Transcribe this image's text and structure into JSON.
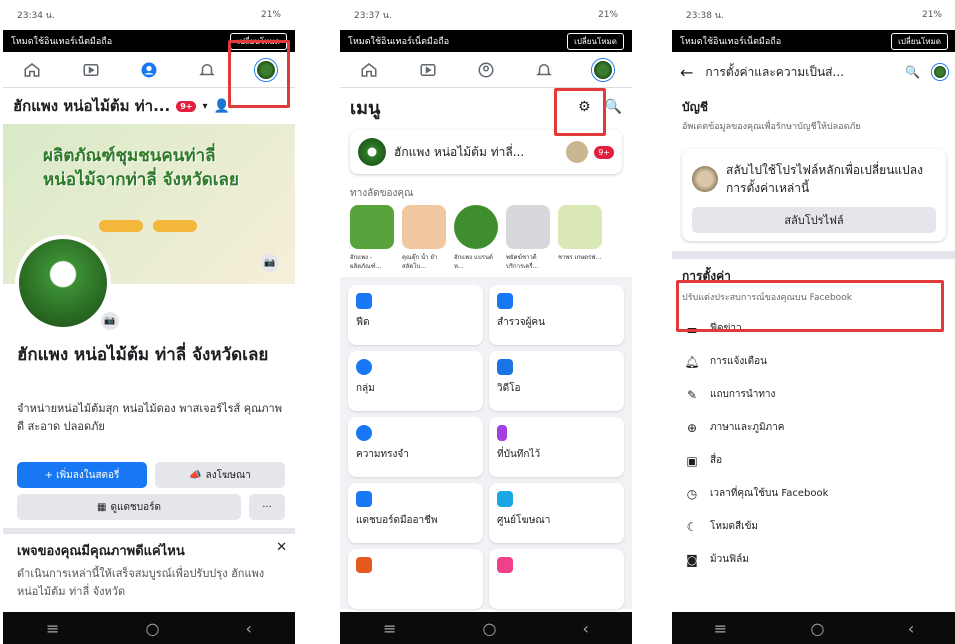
{
  "status": {
    "p1_time": "23:34 น.",
    "p2_time": "23:37 น.",
    "p3_time": "23:38 น.",
    "p1_battery": "21%",
    "p2_battery": "21%",
    "p3_battery": "21%"
  },
  "modebar": {
    "label": "โหมดใช้อินเทอร์เน็ตมือถือ",
    "button": "เปลี่ยนโหมด"
  },
  "panel1": {
    "page_header": "ฮักแพง หน่อไม้ต้ม ท่า...",
    "notif_badge": "9+",
    "cover_title_1": "ผลิตภัณฑ์ชุมชนคนท่าลี่",
    "cover_title_2": "หน่อไม้จากท่าลี่ จังหวัดเลย",
    "page_name": "ฮักแพง หน่อไม้ต้ม ท่าลี่ จังหวัดเลย",
    "page_desc": "จำหน่ายหน่อไม้ต้มสุก หน่อไม้ดอง พาสเจอร์ไรส์ คุณภาพดี สะอาด ปลอดภัย",
    "add_story": "+ เพิ่มลงในสตอรี่",
    "advertise": "ลงโฆษณา",
    "dashboard": "ดูแดชบอร์ด",
    "more": "···",
    "suggest_title": "เพจของคุณมีคุณภาพดีแค่ไหน",
    "suggest_body": "ดำเนินการเหล่านี้ให้เสร็จสมบูรณ์เพื่อปรับปรุง ฮักแพง หน่อไม้ต้ม ท่าลี่ จังหวัด"
  },
  "panel2": {
    "menu_title": "เมนู",
    "profile_name": "ฮักแพง หน่อไม้ต้ม ท่าลี่...",
    "profile_badge": "9+",
    "shortcuts_label": "ทางลัดของคุณ",
    "shortcuts": [
      {
        "label": "ฮักแพง - ผลิตภัณฑ์..."
      },
      {
        "label": "คุณตุ๊ก น้ำ ยำสลัดโบ..."
      },
      {
        "label": "ฮักแพง แบรนด์ ห..."
      },
      {
        "label": "พยัคฆ์ชาวดี บริการเครื่..."
      },
      {
        "label": "ชาพร เกษตรฟ..."
      }
    ],
    "tiles": [
      {
        "label": "ฟีด",
        "color": "#1877f2"
      },
      {
        "label": "สำรวจผู้คน",
        "color": "#1877f2"
      },
      {
        "label": "กลุ่ม",
        "color": "#1877f2"
      },
      {
        "label": "วิดีโอ",
        "color": "#1b74e4"
      },
      {
        "label": "ความทรงจำ",
        "color": "#1877f2"
      },
      {
        "label": "ที่บันทึกไว้",
        "color": "#a33ee0"
      },
      {
        "label": "แดชบอร์ดมืออาชีพ",
        "color": "#1877f2"
      },
      {
        "label": "ศูนย์โฆษณา",
        "color": "#1ba7e4"
      },
      {
        "label": "",
        "color": "#e45a1b"
      },
      {
        "label": "",
        "color": "#f0408a"
      }
    ]
  },
  "panel3": {
    "title": "การตั้งค่าและความเป็นส่...",
    "account_title": "บัญชี",
    "account_desc": "อัพเดตข้อมูลของคุณเพื่อรักษาบัญชีให้ปลอดภัย",
    "switch_text": "สลับไปใช้โปรไฟล์หลักเพื่อเปลี่ยนแปลงการตั้งค่าเหล่านี้",
    "switch_button": "สลับโปรไฟล์",
    "settings_title": "การตั้งค่า",
    "settings_desc": "ปรับแต่งประสบการณ์ของคุณบน Facebook",
    "items": [
      {
        "label": "ฟีดข่าว",
        "icon": "sliders-icon"
      },
      {
        "label": "การแจ้งเตือน",
        "icon": "bell-icon"
      },
      {
        "label": "แถบการนำทาง",
        "icon": "pin-icon"
      },
      {
        "label": "ภาษาและภูมิภาค",
        "icon": "globe-icon"
      },
      {
        "label": "สื่อ",
        "icon": "media-icon"
      },
      {
        "label": "เวลาที่คุณใช้บน Facebook",
        "icon": "clock-icon"
      },
      {
        "label": "โหมดสีเข้ม",
        "icon": "moon-icon"
      },
      {
        "label": "ม้วนฟิล์ม",
        "icon": "camera-icon"
      }
    ]
  }
}
